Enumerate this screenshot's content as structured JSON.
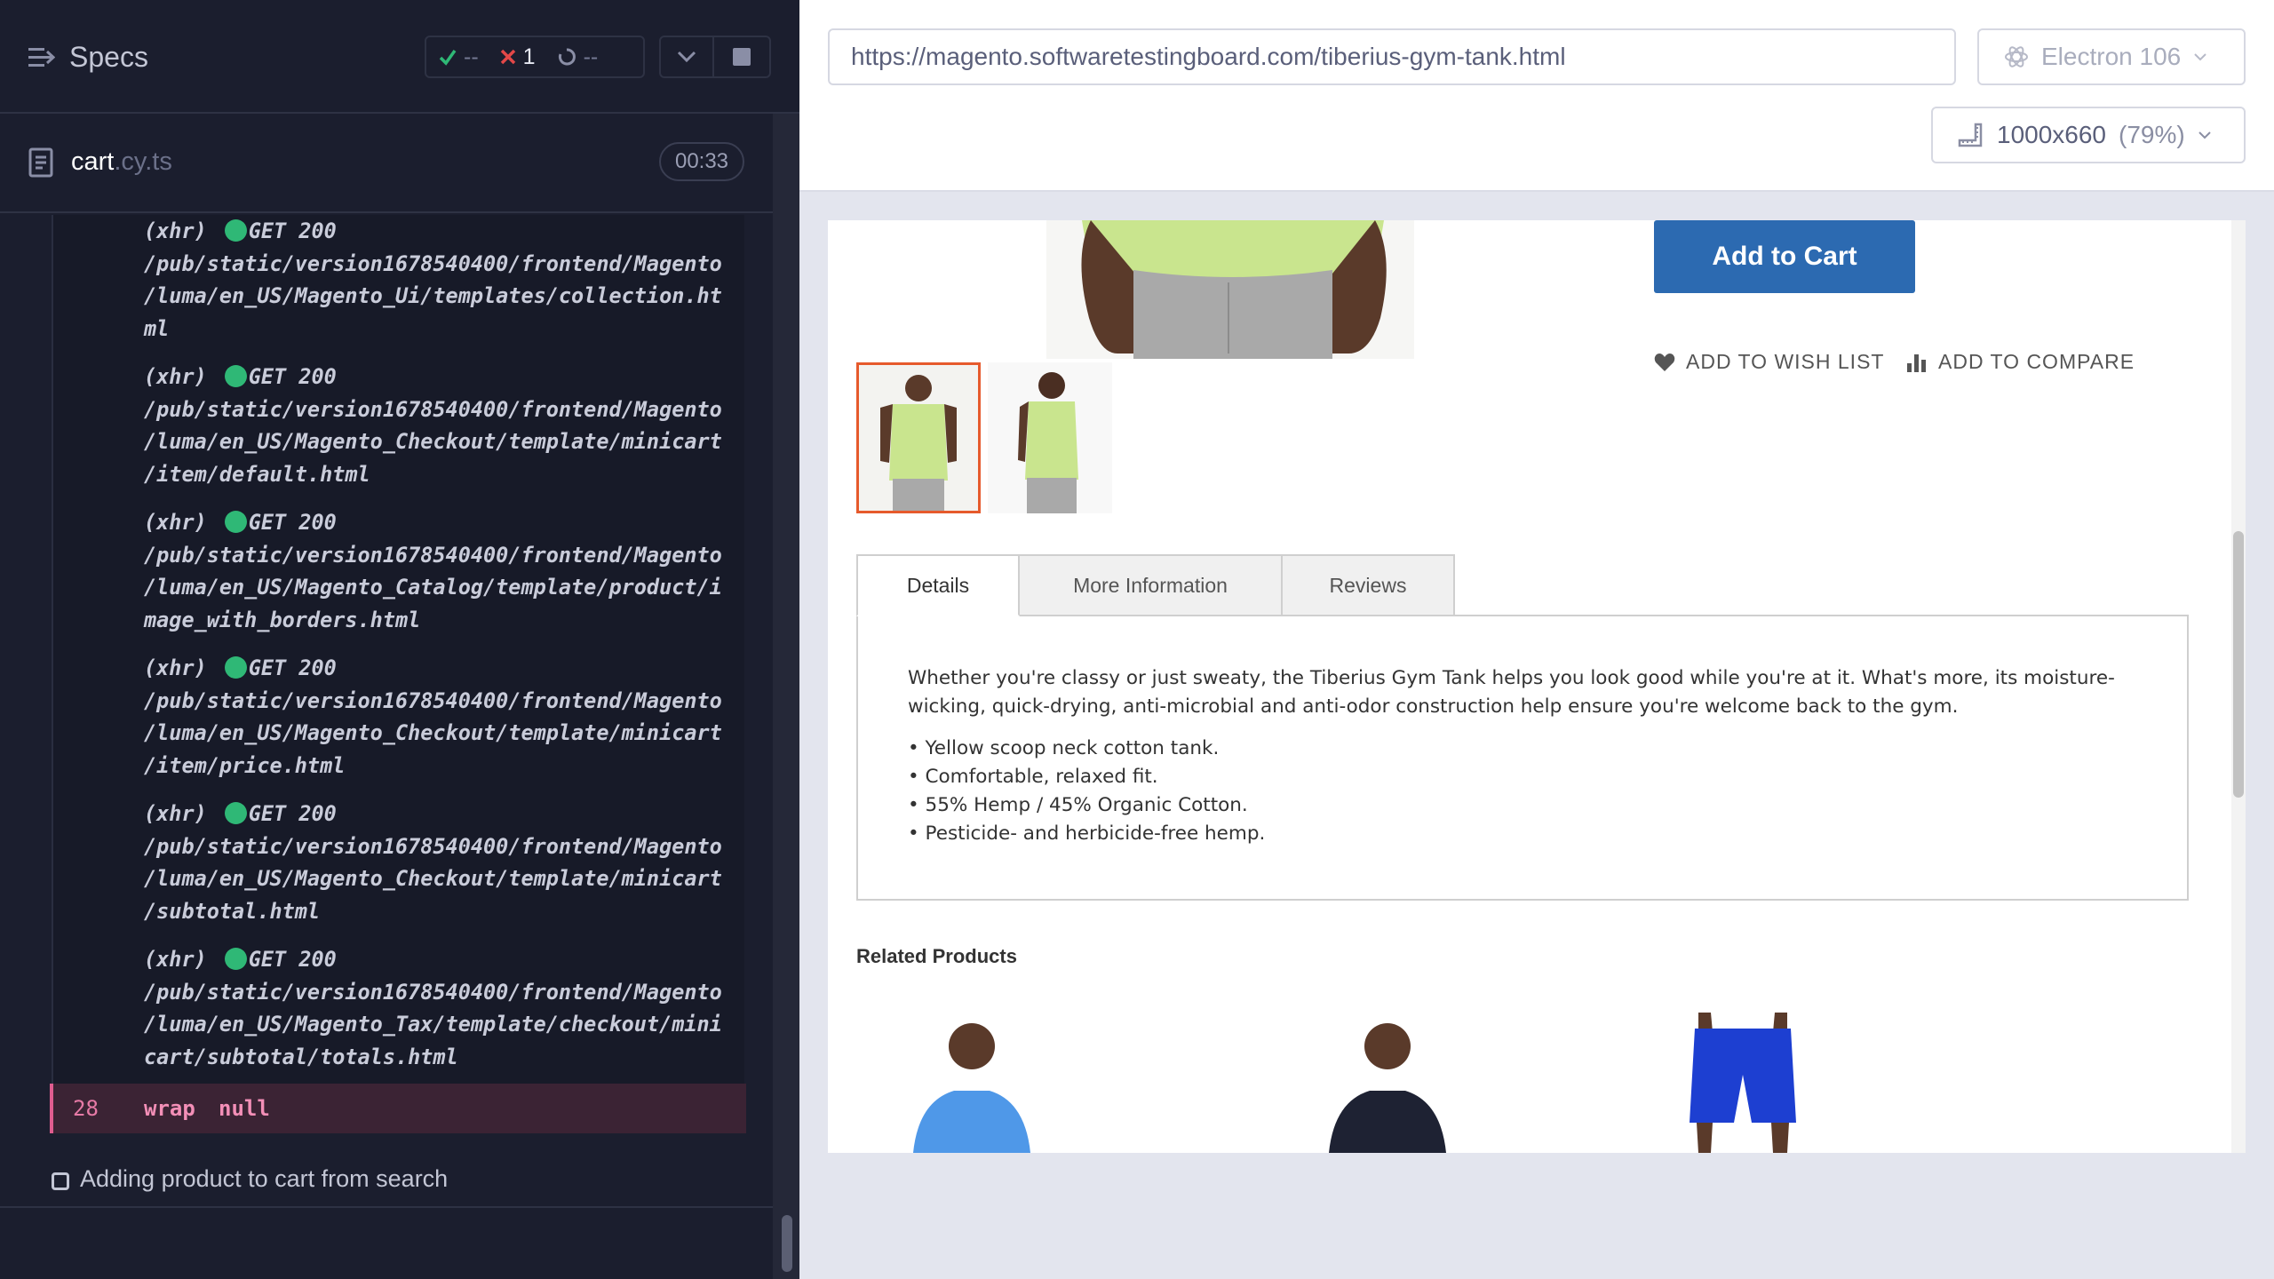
{
  "reporter": {
    "header": {
      "specs_label": "Specs",
      "passed": "--",
      "failed": "1",
      "pending": "--"
    },
    "spec": {
      "file_base": "cart",
      "file_ext": ".cy.ts",
      "duration": "00:33"
    },
    "log": [
      {
        "tag": "(xhr)",
        "status": "GET 200",
        "lines": [
          "/pub/static/version1678540400/frontend/Magento",
          "/luma/en_US/Magento_Ui/templates/collection.ht",
          "ml"
        ]
      },
      {
        "tag": "(xhr)",
        "status": "GET 200",
        "lines": [
          "/pub/static/version1678540400/frontend/Magento",
          "/luma/en_US/Magento_Checkout/template/minicart",
          "/item/default.html"
        ]
      },
      {
        "tag": "(xhr)",
        "status": "GET 200",
        "lines": [
          "/pub/static/version1678540400/frontend/Magento",
          "/luma/en_US/Magento_Catalog/template/product/i",
          "mage_with_borders.html"
        ]
      },
      {
        "tag": "(xhr)",
        "status": "GET 200",
        "lines": [
          "/pub/static/version1678540400/frontend/Magento",
          "/luma/en_US/Magento_Checkout/template/minicart",
          "/item/price.html"
        ]
      },
      {
        "tag": "(xhr)",
        "status": "GET 200",
        "lines": [
          "/pub/static/version1678540400/frontend/Magento",
          "/luma/en_US/Magento_Checkout/template/minicart",
          "/subtotal.html"
        ]
      },
      {
        "tag": "(xhr)",
        "status": "GET 200",
        "lines": [
          "/pub/static/version1678540400/frontend/Magento",
          "/luma/en_US/Magento_Tax/template/checkout/mini",
          "cart/subtotal/totals.html"
        ]
      }
    ],
    "wrap_row": {
      "number": "28",
      "command": "wrap",
      "value": "null"
    },
    "test_title": "Adding product to cart from search"
  },
  "aut": {
    "url": "https://magento.softwaretestingboard.com/tiberius-gym-tank.html",
    "browser": "Electron 106",
    "viewport": "1000x660",
    "viewport_scale": "(79%)",
    "product": {
      "add_to_cart": "Add to Cart",
      "wish_list": "ADD TO WISH LIST",
      "compare": "ADD TO COMPARE",
      "tabs": [
        "Details",
        "More Information",
        "Reviews"
      ],
      "description": "Whether you're classy or just sweaty, the Tiberius Gym Tank helps you look good while you're at it. What's more, its moisture-wicking, quick-drying, anti-microbial and anti-odor construction help ensure you're welcome back to the gym.",
      "bullets": [
        "• Yellow scoop neck cotton tank.",
        "• Comfortable, relaxed fit.",
        "• 55% Hemp / 45% Organic Cotton.",
        "• Pesticide- and herbicide-free hemp."
      ],
      "related_title": "Related Products"
    },
    "colors": {
      "accent_blue": "#2c6ab1",
      "thumb_active": "#e65a2c",
      "pass_green": "#2fb876",
      "fail_red": "#e34848"
    }
  }
}
